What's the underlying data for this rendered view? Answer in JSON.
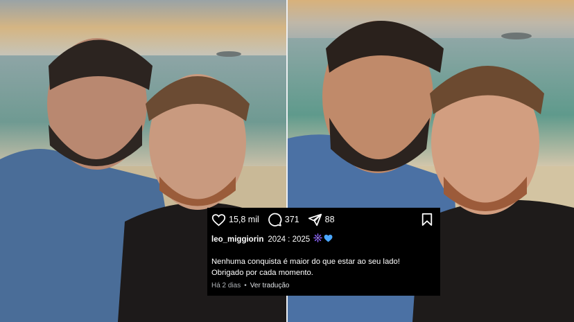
{
  "post": {
    "likes": "15,8 mil",
    "comments": "371",
    "shares": "88",
    "username": "leo_miggiorin",
    "title_text": "2024 : 2025",
    "caption_line_1": "Nenhuma conquista é maior do que estar ao seu lado!",
    "caption_line_2": "Obrigado por cada momento.",
    "timestamp": "Há 2 dias",
    "separator": "•",
    "translate_link": "Ver tradução"
  },
  "icons": {
    "like": "heart-icon",
    "comment": "comment-bubble-icon",
    "share": "paper-plane-icon",
    "save": "bookmark-icon",
    "emojis": [
      "purple-fireworks-icon",
      "blue-heart-icon"
    ]
  },
  "colors": {
    "card_bg": "#000000",
    "text": "#ffffff",
    "meta_text": "#b0b4b8",
    "blue_heart": "#4aa7ff",
    "purple_fireworks": "#8c63ff"
  }
}
